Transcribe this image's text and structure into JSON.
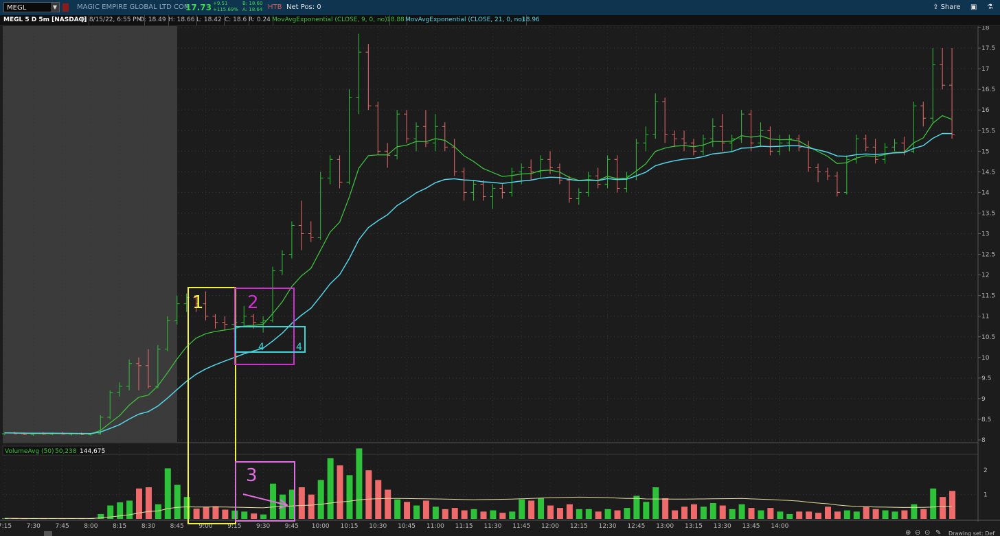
{
  "toolbar": {
    "symbol": "MEGL",
    "company": "MAGIC EMPIRE GLOBAL LTD COM",
    "last": "17.73",
    "change": "+9.51",
    "change_pct": "+115.69%",
    "bid": "B: 18.60",
    "ask": "A: 18.64",
    "htb": "HTB",
    "net_pos": "Net Pos: 0",
    "share_label": "Share"
  },
  "status": {
    "title": "MEGL 5 D 5m [NASDAQ]",
    "date": "D: 8/15/22, 6:55 PM",
    "open": "O: 18.49",
    "high": "H: 18.66",
    "low": "L: 18.42",
    "close": "C: 18.6",
    "range": "R: 0.24",
    "ema9_label": "MovAvgExponential (CLOSE, 9, 0, no)",
    "ema9_value": "18.88",
    "ema21_label": "MovAvgExponential (CLOSE, 21, 0, no)",
    "ema21_value": "18.96"
  },
  "volume_pane": {
    "label": "VolumeAvg (50)",
    "avg": "50,238",
    "current": "144,675"
  },
  "annotations": [
    {
      "label": "1",
      "color": "#f4f43c"
    },
    {
      "label": "2",
      "color": "#d030d0"
    },
    {
      "label": "3",
      "color": "#e070e0"
    },
    {
      "label": "4",
      "color": "#3cd6d6"
    },
    {
      "label": "4",
      "color": "#3cd6d6"
    }
  ],
  "footer": {
    "drawing_set": "Drawing set: Def"
  },
  "colors": {
    "up": "#2ec23a",
    "down": "#ef6b6b",
    "ema9": "#3fbf3f",
    "ema21": "#55d5e8",
    "volavg": "#e8e0a0",
    "premarket_shade": "#3b3b3b"
  },
  "chart_data": {
    "type": "ohlc-volume",
    "interval": "5m",
    "x_tick_labels": [
      "7:15",
      "7:30",
      "7:45",
      "8:00",
      "8:15",
      "8:30",
      "8:45",
      "9:00",
      "9:15",
      "9:30",
      "9:45",
      "10:00",
      "10:15",
      "10:30",
      "10:45",
      "11:00",
      "11:15",
      "11:30",
      "11:45",
      "12:00",
      "12:15",
      "12:30",
      "12:45",
      "13:00",
      "13:15",
      "13:30",
      "13:45",
      "14:00"
    ],
    "y_ticks": [
      "8",
      "8.5",
      "9",
      "9.5",
      "10",
      "10.5",
      "11",
      "11.5",
      "12",
      "12.5",
      "13",
      "13.5",
      "14",
      "14.5",
      "15",
      "15.5",
      "16",
      "16.5",
      "17",
      "17.5",
      "18"
    ],
    "ylim": [
      8,
      18
    ],
    "volume_ticks": [
      "1",
      "2"
    ],
    "volume_ylim": [
      0,
      2.6
    ],
    "series": [
      {
        "name": "MovAvgExponential (CLOSE, 9, 0, no)",
        "role": "ema9"
      },
      {
        "name": "MovAvgExponential (CLOSE, 21, 0, no)",
        "role": "ema21"
      }
    ],
    "bars": [
      {
        "t": "7:15",
        "o": 8.15,
        "h": 8.2,
        "l": 8.12,
        "c": 8.17,
        "v": 0.02
      },
      {
        "t": "7:20",
        "o": 8.17,
        "h": 8.2,
        "l": 8.14,
        "c": 8.15,
        "v": 0.02
      },
      {
        "t": "7:25",
        "o": 8.15,
        "h": 8.18,
        "l": 8.12,
        "c": 8.13,
        "v": 0.01
      },
      {
        "t": "7:30",
        "o": 8.13,
        "h": 8.17,
        "l": 8.1,
        "c": 8.15,
        "v": 0.02
      },
      {
        "t": "7:35",
        "o": 8.15,
        "h": 8.19,
        "l": 8.12,
        "c": 8.14,
        "v": 0.01
      },
      {
        "t": "7:40",
        "o": 8.14,
        "h": 8.18,
        "l": 8.12,
        "c": 8.16,
        "v": 0.02
      },
      {
        "t": "7:45",
        "o": 8.16,
        "h": 8.2,
        "l": 8.13,
        "c": 8.14,
        "v": 0.01
      },
      {
        "t": "7:50",
        "o": 8.14,
        "h": 8.17,
        "l": 8.11,
        "c": 8.15,
        "v": 0.02
      },
      {
        "t": "7:55",
        "o": 8.15,
        "h": 8.18,
        "l": 8.12,
        "c": 8.13,
        "v": 0.01
      },
      {
        "t": "8:00",
        "o": 8.13,
        "h": 8.17,
        "l": 8.1,
        "c": 8.15,
        "v": 0.02
      },
      {
        "t": "8:05",
        "o": 8.15,
        "h": 8.6,
        "l": 8.13,
        "c": 8.55,
        "v": 0.2
      },
      {
        "t": "8:10",
        "o": 8.55,
        "h": 9.2,
        "l": 8.5,
        "c": 9.15,
        "v": 0.55
      },
      {
        "t": "8:15",
        "o": 9.15,
        "h": 9.4,
        "l": 9.05,
        "c": 9.3,
        "v": 0.68
      },
      {
        "t": "8:20",
        "o": 9.3,
        "h": 9.95,
        "l": 9.2,
        "c": 9.85,
        "v": 0.75
      },
      {
        "t": "8:25",
        "o": 9.85,
        "h": 10.0,
        "l": 9.2,
        "c": 9.8,
        "v": 1.25
      },
      {
        "t": "8:30",
        "o": 9.8,
        "h": 10.2,
        "l": 9.25,
        "c": 9.3,
        "v": 1.3
      },
      {
        "t": "8:35",
        "o": 9.3,
        "h": 10.3,
        "l": 9.25,
        "c": 10.2,
        "v": 0.6
      },
      {
        "t": "8:40",
        "o": 10.2,
        "h": 11.0,
        "l": 10.15,
        "c": 10.9,
        "v": 2.08
      },
      {
        "t": "8:45",
        "o": 10.9,
        "h": 11.5,
        "l": 10.8,
        "c": 11.3,
        "v": 1.4
      },
      {
        "t": "8:50",
        "o": 11.3,
        "h": 11.55,
        "l": 11.1,
        "c": 11.45,
        "v": 0.9
      },
      {
        "t": "8:55",
        "o": 11.45,
        "h": 11.5,
        "l": 11.1,
        "c": 11.3,
        "v": 0.42
      },
      {
        "t": "9:00",
        "o": 11.3,
        "h": 11.6,
        "l": 10.9,
        "c": 11.0,
        "v": 0.48
      },
      {
        "t": "9:05",
        "o": 11.0,
        "h": 11.05,
        "l": 10.7,
        "c": 10.85,
        "v": 0.52
      },
      {
        "t": "9:10",
        "o": 10.85,
        "h": 11.0,
        "l": 10.65,
        "c": 10.8,
        "v": 0.38
      },
      {
        "t": "9:15",
        "o": 10.8,
        "h": 10.95,
        "l": 10.6,
        "c": 10.85,
        "v": 0.34
      },
      {
        "t": "9:20",
        "o": 10.85,
        "h": 11.25,
        "l": 10.75,
        "c": 11.0,
        "v": 0.3
      },
      {
        "t": "9:25",
        "o": 11.0,
        "h": 11.05,
        "l": 10.7,
        "c": 10.85,
        "v": 0.22
      },
      {
        "t": "9:30",
        "o": 10.85,
        "h": 11.0,
        "l": 10.6,
        "c": 10.9,
        "v": 0.18
      },
      {
        "t": "9:35",
        "o": 10.9,
        "h": 12.2,
        "l": 10.85,
        "c": 12.1,
        "v": 1.45
      },
      {
        "t": "9:40",
        "o": 12.1,
        "h": 12.6,
        "l": 12.0,
        "c": 12.5,
        "v": 1.0
      },
      {
        "t": "9:45",
        "o": 12.5,
        "h": 13.3,
        "l": 12.4,
        "c": 13.2,
        "v": 1.2
      },
      {
        "t": "9:50",
        "o": 13.2,
        "h": 13.8,
        "l": 12.6,
        "c": 13.0,
        "v": 1.3
      },
      {
        "t": "9:55",
        "o": 13.0,
        "h": 13.3,
        "l": 12.8,
        "c": 12.9,
        "v": 1.0
      },
      {
        "t": "10:00",
        "o": 12.9,
        "h": 14.5,
        "l": 12.85,
        "c": 14.35,
        "v": 1.6
      },
      {
        "t": "10:05",
        "o": 14.35,
        "h": 14.9,
        "l": 14.2,
        "c": 14.8,
        "v": 2.5
      },
      {
        "t": "10:10",
        "o": 14.8,
        "h": 14.9,
        "l": 14.1,
        "c": 14.25,
        "v": 2.2
      },
      {
        "t": "10:15",
        "o": 14.25,
        "h": 16.5,
        "l": 14.2,
        "c": 16.3,
        "v": 1.8
      },
      {
        "t": "10:20",
        "o": 16.3,
        "h": 17.85,
        "l": 15.9,
        "c": 17.4,
        "v": 2.9
      },
      {
        "t": "10:25",
        "o": 17.4,
        "h": 17.6,
        "l": 16.0,
        "c": 16.1,
        "v": 2.0
      },
      {
        "t": "10:30",
        "o": 16.1,
        "h": 16.2,
        "l": 14.9,
        "c": 15.0,
        "v": 1.6
      },
      {
        "t": "10:35",
        "o": 15.0,
        "h": 15.2,
        "l": 14.6,
        "c": 14.9,
        "v": 1.2
      },
      {
        "t": "10:40",
        "o": 14.9,
        "h": 16.0,
        "l": 14.8,
        "c": 15.9,
        "v": 0.8
      },
      {
        "t": "10:45",
        "o": 15.9,
        "h": 16.0,
        "l": 15.2,
        "c": 15.3,
        "v": 0.7
      },
      {
        "t": "10:50",
        "o": 15.3,
        "h": 15.7,
        "l": 15.0,
        "c": 15.6,
        "v": 0.55
      },
      {
        "t": "10:55",
        "o": 15.6,
        "h": 16.0,
        "l": 15.1,
        "c": 15.2,
        "v": 0.75
      },
      {
        "t": "11:00",
        "o": 15.2,
        "h": 15.9,
        "l": 15.0,
        "c": 15.6,
        "v": 0.5
      },
      {
        "t": "11:05",
        "o": 15.6,
        "h": 15.7,
        "l": 15.0,
        "c": 15.1,
        "v": 0.4
      },
      {
        "t": "11:10",
        "o": 15.1,
        "h": 15.3,
        "l": 14.4,
        "c": 14.5,
        "v": 0.45
      },
      {
        "t": "11:15",
        "o": 14.5,
        "h": 14.6,
        "l": 13.8,
        "c": 14.0,
        "v": 0.35
      },
      {
        "t": "11:20",
        "o": 14.0,
        "h": 14.3,
        "l": 13.8,
        "c": 14.2,
        "v": 0.4
      },
      {
        "t": "11:25",
        "o": 14.2,
        "h": 14.3,
        "l": 13.8,
        "c": 13.9,
        "v": 0.3
      },
      {
        "t": "11:30",
        "o": 13.9,
        "h": 14.2,
        "l": 13.6,
        "c": 14.1,
        "v": 0.35
      },
      {
        "t": "11:35",
        "o": 14.1,
        "h": 14.2,
        "l": 13.85,
        "c": 14.0,
        "v": 0.25
      },
      {
        "t": "11:40",
        "o": 14.0,
        "h": 14.6,
        "l": 13.9,
        "c": 14.5,
        "v": 0.3
      },
      {
        "t": "11:45",
        "o": 14.5,
        "h": 14.7,
        "l": 14.2,
        "c": 14.6,
        "v": 0.8
      },
      {
        "t": "11:50",
        "o": 14.6,
        "h": 14.8,
        "l": 14.3,
        "c": 14.5,
        "v": 0.75
      },
      {
        "t": "11:55",
        "o": 14.5,
        "h": 14.9,
        "l": 14.35,
        "c": 14.8,
        "v": 0.85
      },
      {
        "t": "12:00",
        "o": 14.8,
        "h": 15.0,
        "l": 14.45,
        "c": 14.6,
        "v": 0.55
      },
      {
        "t": "12:05",
        "o": 14.6,
        "h": 14.7,
        "l": 14.2,
        "c": 14.3,
        "v": 0.45
      },
      {
        "t": "12:10",
        "o": 14.3,
        "h": 14.4,
        "l": 13.75,
        "c": 13.85,
        "v": 0.6
      },
      {
        "t": "12:15",
        "o": 13.85,
        "h": 14.1,
        "l": 13.7,
        "c": 14.0,
        "v": 0.4
      },
      {
        "t": "12:20",
        "o": 14.0,
        "h": 14.5,
        "l": 13.9,
        "c": 14.4,
        "v": 0.4
      },
      {
        "t": "12:25",
        "o": 14.4,
        "h": 14.6,
        "l": 14.1,
        "c": 14.2,
        "v": 0.3
      },
      {
        "t": "12:30",
        "o": 14.2,
        "h": 14.9,
        "l": 14.1,
        "c": 14.8,
        "v": 0.4
      },
      {
        "t": "12:35",
        "o": 14.8,
        "h": 14.9,
        "l": 14.0,
        "c": 14.1,
        "v": 0.35
      },
      {
        "t": "12:40",
        "o": 14.1,
        "h": 14.5,
        "l": 14.0,
        "c": 14.4,
        "v": 0.45
      },
      {
        "t": "12:45",
        "o": 14.4,
        "h": 15.3,
        "l": 14.3,
        "c": 15.2,
        "v": 0.95
      },
      {
        "t": "12:50",
        "o": 15.2,
        "h": 15.6,
        "l": 15.0,
        "c": 15.4,
        "v": 0.7
      },
      {
        "t": "12:55",
        "o": 15.4,
        "h": 16.4,
        "l": 15.3,
        "c": 16.2,
        "v": 1.3
      },
      {
        "t": "13:00",
        "o": 16.2,
        "h": 16.3,
        "l": 15.2,
        "c": 15.4,
        "v": 0.85
      },
      {
        "t": "13:05",
        "o": 15.4,
        "h": 15.5,
        "l": 15.1,
        "c": 15.3,
        "v": 0.35
      },
      {
        "t": "13:10",
        "o": 15.3,
        "h": 15.5,
        "l": 15.0,
        "c": 15.2,
        "v": 0.5
      },
      {
        "t": "13:15",
        "o": 15.2,
        "h": 15.3,
        "l": 14.9,
        "c": 15.0,
        "v": 0.6
      },
      {
        "t": "13:20",
        "o": 15.0,
        "h": 15.4,
        "l": 14.9,
        "c": 15.3,
        "v": 0.5
      },
      {
        "t": "13:25",
        "o": 15.3,
        "h": 15.8,
        "l": 15.1,
        "c": 15.6,
        "v": 0.65
      },
      {
        "t": "13:30",
        "o": 15.6,
        "h": 15.9,
        "l": 15.0,
        "c": 15.2,
        "v": 0.55
      },
      {
        "t": "13:35",
        "o": 15.2,
        "h": 15.4,
        "l": 15.0,
        "c": 15.3,
        "v": 0.4
      },
      {
        "t": "13:40",
        "o": 15.3,
        "h": 16.0,
        "l": 15.2,
        "c": 15.9,
        "v": 0.6
      },
      {
        "t": "13:45",
        "o": 15.9,
        "h": 16.0,
        "l": 15.0,
        "c": 15.2,
        "v": 0.45
      },
      {
        "t": "13:50",
        "o": 15.2,
        "h": 15.7,
        "l": 15.1,
        "c": 15.5,
        "v": 0.35
      },
      {
        "t": "13:55",
        "o": 15.5,
        "h": 15.6,
        "l": 14.9,
        "c": 15.0,
        "v": 0.45
      },
      {
        "t": "14:00",
        "o": 15.0,
        "h": 15.4,
        "l": 14.9,
        "c": 15.2,
        "v": 0.3
      },
      {
        "t": "14:05",
        "o": 15.2,
        "h": 15.4,
        "l": 15.0,
        "c": 15.3,
        "v": 0.2
      },
      {
        "t": "14:10",
        "o": 15.3,
        "h": 15.4,
        "l": 15.0,
        "c": 15.1,
        "v": 0.3
      },
      {
        "t": "14:15",
        "o": 15.1,
        "h": 15.25,
        "l": 14.5,
        "c": 14.6,
        "v": 0.3
      },
      {
        "t": "14:20",
        "o": 14.6,
        "h": 14.7,
        "l": 14.25,
        "c": 14.5,
        "v": 0.25
      },
      {
        "t": "14:25",
        "o": 14.5,
        "h": 14.6,
        "l": 14.3,
        "c": 14.4,
        "v": 0.5
      },
      {
        "t": "14:30",
        "o": 14.4,
        "h": 14.5,
        "l": 13.9,
        "c": 14.0,
        "v": 0.3
      },
      {
        "t": "14:35",
        "o": 14.0,
        "h": 14.9,
        "l": 13.95,
        "c": 14.8,
        "v": 0.35
      },
      {
        "t": "14:40",
        "o": 14.8,
        "h": 15.4,
        "l": 14.7,
        "c": 15.3,
        "v": 0.3
      },
      {
        "t": "14:45",
        "o": 15.3,
        "h": 15.4,
        "l": 15.0,
        "c": 15.1,
        "v": 0.5
      },
      {
        "t": "14:50",
        "o": 15.1,
        "h": 15.3,
        "l": 14.7,
        "c": 14.8,
        "v": 0.4
      },
      {
        "t": "14:55",
        "o": 14.8,
        "h": 15.2,
        "l": 14.7,
        "c": 15.1,
        "v": 0.35
      },
      {
        "t": "15:00",
        "o": 15.1,
        "h": 15.3,
        "l": 15.0,
        "c": 15.2,
        "v": 0.3
      },
      {
        "t": "15:05",
        "o": 15.2,
        "h": 15.35,
        "l": 14.9,
        "c": 15.0,
        "v": 0.35
      },
      {
        "t": "15:10",
        "o": 15.0,
        "h": 16.2,
        "l": 14.95,
        "c": 16.1,
        "v": 0.6
      },
      {
        "t": "15:15",
        "o": 16.1,
        "h": 16.2,
        "l": 15.6,
        "c": 15.8,
        "v": 0.4
      },
      {
        "t": "15:20",
        "o": 15.8,
        "h": 17.5,
        "l": 15.7,
        "c": 17.1,
        "v": 1.25
      },
      {
        "t": "15:25",
        "o": 17.1,
        "h": 17.5,
        "l": 16.5,
        "c": 16.6,
        "v": 0.9
      },
      {
        "t": "15:30",
        "o": 16.6,
        "h": 17.5,
        "l": 15.3,
        "c": 15.4,
        "v": 1.15
      }
    ]
  }
}
